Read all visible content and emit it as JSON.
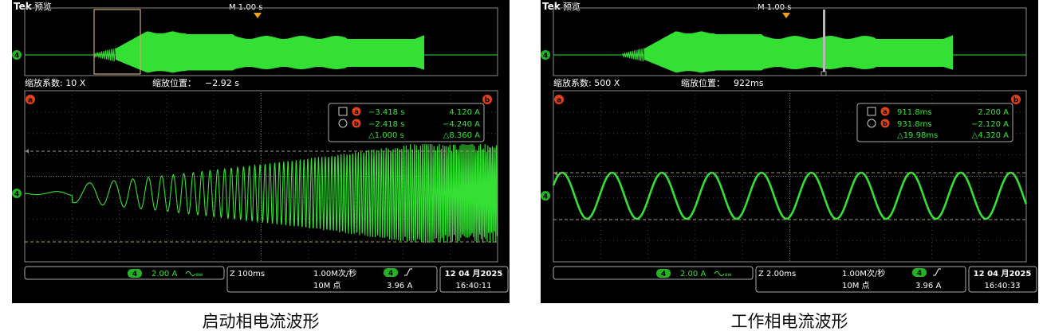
{
  "colors": {
    "trace": "#35e035",
    "ch4": "#23b423",
    "cursor": "#e0401b",
    "frame": "#8c8c8c",
    "text": "#ffffff"
  },
  "panels": [
    {
      "id": "left",
      "header": {
        "brand": "Tek",
        "mode": "预览",
        "timebase": "M 1.00 s"
      },
      "zoom": {
        "factor": "缩放系数: 10 X",
        "position_label": "缩放位置：",
        "position_value": "−2.92 s"
      },
      "cursors": {
        "a_label": "a",
        "b_label": "b",
        "a_time": "−3.418 s",
        "a_value": "4.120 A",
        "b_time": "−2.418 s",
        "b_value": "−4.240 A",
        "delta_time": "△1.000 s",
        "delta_value": "△8.360 A"
      },
      "channel": {
        "number": "4",
        "scale": "2.00 A",
        "coupling_icon": "ac-wave-icon"
      },
      "timebase": {
        "zoom": "Z 100ms",
        "sample_rate": "1.00M次/秒",
        "record": "10M 点",
        "trig_channel": "4",
        "trig_slope_icon": "rising-edge-icon",
        "trig_level": "3.96 A"
      },
      "clock": {
        "date": "12 04 月2025",
        "time": "16:40:11"
      },
      "waveform": "startup-chirp",
      "caption": "启动相电流波形"
    },
    {
      "id": "right",
      "header": {
        "brand": "Tek",
        "mode": "预览",
        "timebase": "M 1.00 s"
      },
      "zoom": {
        "factor": "缩放系数: 500 X",
        "position_label": "缩放位置：",
        "position_value": "922ms"
      },
      "cursors": {
        "a_label": "a",
        "b_label": "b",
        "a_time": "911.8ms",
        "a_value": "2.200 A",
        "b_time": "931.8ms",
        "b_value": "−2.120 A",
        "delta_time": "△19.98ms",
        "delta_value": "△4.320 A"
      },
      "channel": {
        "number": "4",
        "scale": "2.00 A",
        "coupling_icon": "ac-wave-icon"
      },
      "timebase": {
        "zoom": "Z 2.00ms",
        "sample_rate": "1.00M次/秒",
        "record": "10M 点",
        "trig_channel": "4",
        "trig_slope_icon": "rising-edge-icon",
        "trig_level": "3.96 A"
      },
      "clock": {
        "date": "12 04 月2025",
        "time": "16:40:33"
      },
      "waveform": "steady-sine",
      "caption": "工作相电流波形"
    }
  ]
}
